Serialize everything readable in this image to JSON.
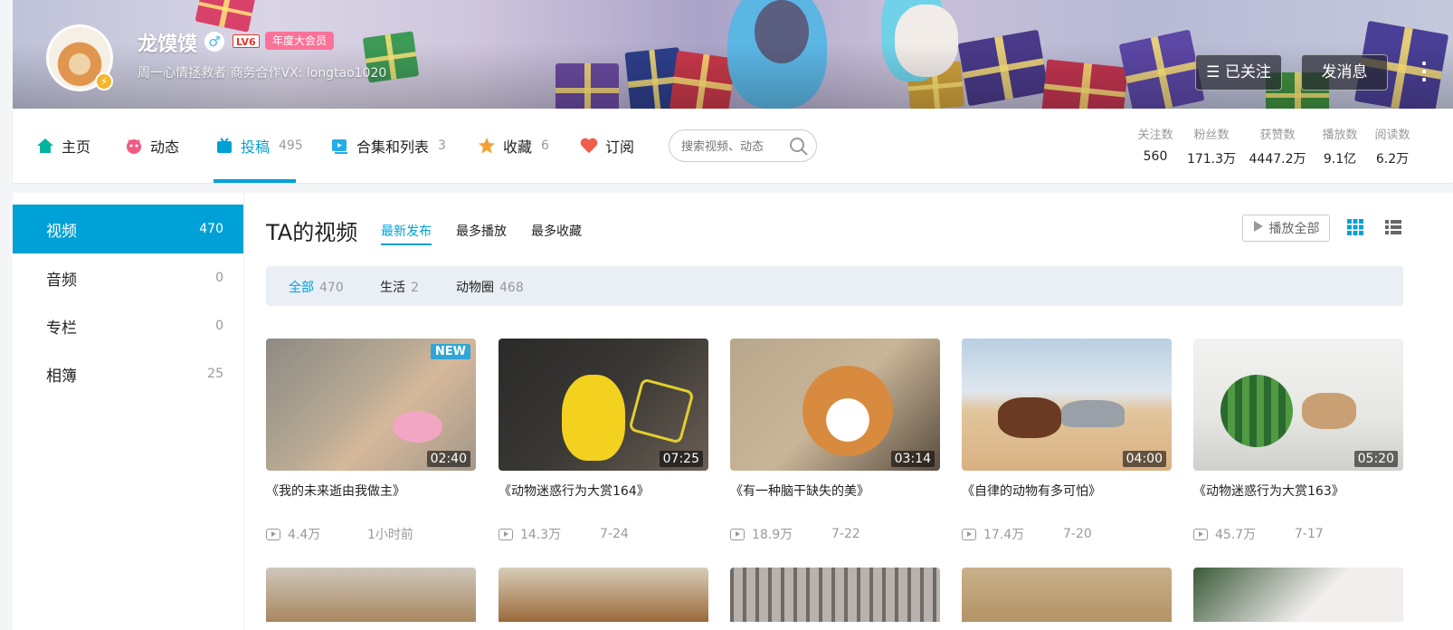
{
  "header": {
    "username": "龙馍馍",
    "gender_icon": "male-icon",
    "level": "LV6",
    "vip": "年度大会员",
    "sign": "周一心情拯救者 商务合作VX: longtao1020",
    "follow_label": "已关注",
    "message_label": "发消息",
    "more_label": "⋮"
  },
  "nav": {
    "items": [
      {
        "label": "主页",
        "count": "",
        "icon": "home-icon"
      },
      {
        "label": "动态",
        "count": "",
        "icon": "dynamic-icon"
      },
      {
        "label": "投稿",
        "count": "495",
        "icon": "upload-icon"
      },
      {
        "label": "合集和列表",
        "count": "3",
        "icon": "collection-icon"
      },
      {
        "label": "收藏",
        "count": "6",
        "icon": "favorite-icon"
      },
      {
        "label": "订阅",
        "count": "",
        "icon": "subscribe-icon"
      }
    ],
    "active": "投稿",
    "search_placeholder": "搜索视频、动态",
    "stats": [
      {
        "label": "关注数",
        "value": "560"
      },
      {
        "label": "粉丝数",
        "value": "171.3万"
      },
      {
        "label": "获赞数",
        "value": "4447.2万"
      },
      {
        "label": "播放数",
        "value": "9.1亿"
      },
      {
        "label": "阅读数",
        "value": "6.2万"
      }
    ]
  },
  "sidebar": {
    "items": [
      {
        "label": "视频",
        "count": "470"
      },
      {
        "label": "音频",
        "count": "0"
      },
      {
        "label": "专栏",
        "count": "0"
      },
      {
        "label": "相簿",
        "count": "25"
      }
    ],
    "active": "视频"
  },
  "main": {
    "title": "TA的视频",
    "sorts": [
      "最新发布",
      "最多播放",
      "最多收藏"
    ],
    "active_sort": "最新发布",
    "play_all": "播放全部",
    "filters": [
      {
        "label": "全部",
        "count": "470"
      },
      {
        "label": "生活",
        "count": "2"
      },
      {
        "label": "动物圈",
        "count": "468"
      }
    ],
    "active_filter": "全部",
    "videos": [
      {
        "title": "《我的未来逝由我做主》",
        "duration": "02:40",
        "views": "4.4万",
        "date": "1小时前",
        "badge": "NEW"
      },
      {
        "title": "《动物迷惑行为大赏164》",
        "duration": "07:25",
        "views": "14.3万",
        "date": "7-24",
        "badge": ""
      },
      {
        "title": "《有一种脑干缺失的美》",
        "duration": "03:14",
        "views": "18.9万",
        "date": "7-22",
        "badge": ""
      },
      {
        "title": "《自律的动物有多可怕》",
        "duration": "04:00",
        "views": "17.4万",
        "date": "7-20",
        "badge": ""
      },
      {
        "title": "《动物迷惑行为大赏163》",
        "duration": "05:20",
        "views": "45.7万",
        "date": "7-17",
        "badge": ""
      }
    ]
  },
  "colors": {
    "accent": "#00a1d6",
    "vip": "#fb7299",
    "sidebar_active": "#00a1d6"
  }
}
